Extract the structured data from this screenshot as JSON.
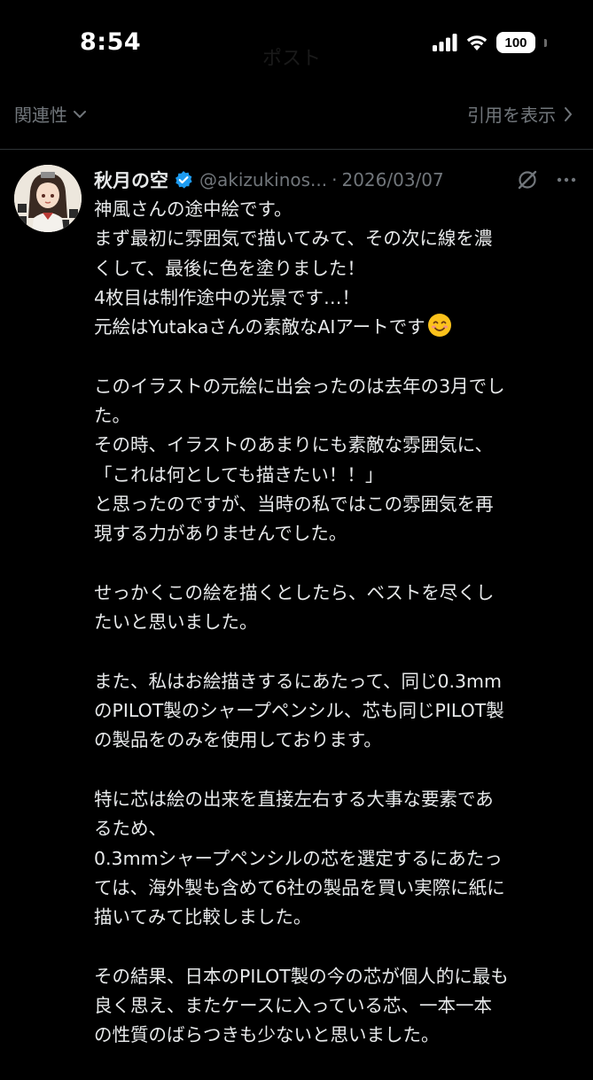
{
  "status_bar": {
    "time": "8:54",
    "ghost_title": "ポスト",
    "battery": "100",
    "icons": [
      "signal-icon",
      "wifi-icon",
      "battery-icon"
    ]
  },
  "toolbar": {
    "sort_label": "関連性",
    "quotes_label": "引用を表示"
  },
  "post": {
    "display_name": "秋月の空",
    "verified": true,
    "handle": "@akizukinos...",
    "separator": "·",
    "date": "2026/03/07",
    "paragraphs": [
      {
        "lines": [
          "神風さんの途中絵です。",
          "まず最初に雰囲気で描いてみて、その次に線を濃",
          "くして、最後に色を塗りました！",
          "4枚目は制作途中の光景です…！",
          "元絵はYutakaさんの素敵なAIアートです"
        ]
      },
      {
        "lines": [
          "このイラストの元絵に出会ったのは去年の3月でし",
          "た。",
          "その時、イラストのあまりにも素敵な雰囲気に、",
          "「これは何としても描きたい！！」",
          "と思ったのですが、当時の私ではこの雰囲気を再",
          "現する力がありませんでした。"
        ]
      },
      {
        "lines": [
          "せっかくこの絵を描くとしたら、ベストを尽くし",
          "たいと思いました。"
        ]
      },
      {
        "lines": [
          "また、私はお絵描きするにあたって、同じ0.3mm",
          "のPILOT製のシャープペンシル、芯も同じPILOT製",
          "の製品をのみを使用しております。"
        ]
      },
      {
        "lines": [
          "特に芯は絵の出来を直接左右する大事な要素であ",
          "るため、",
          "0.3mmシャープペンシルの芯を選定するにあたっ",
          "ては、海外製も含めて6社の製品を買い実際に紙に",
          "描いてみて比較しました。"
        ]
      },
      {
        "lines": [
          "その結果、日本のPILOT製の今の芯が個人的に最も",
          "良く思え、またケースに入っている芯、一本一本",
          "の性質のばらつきも少ないと思いました。"
        ]
      }
    ],
    "emoji": "smiling-face-emoji"
  },
  "colors": {
    "background": "#000000",
    "text": "#e7e9ea",
    "muted": "#71767b",
    "divider": "#2f3336",
    "verified": "#1d9bf0"
  }
}
